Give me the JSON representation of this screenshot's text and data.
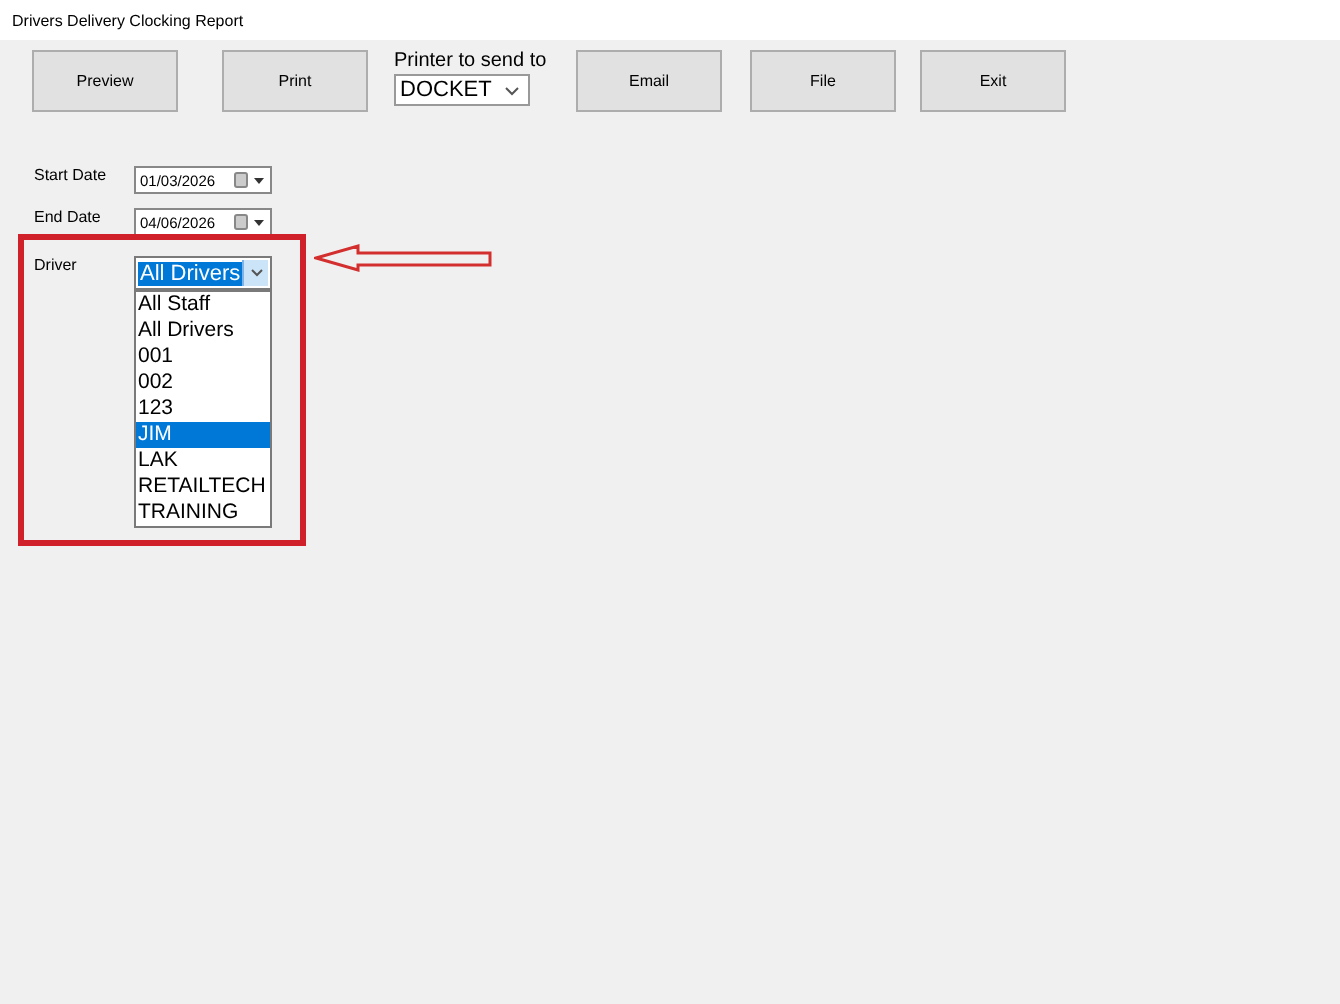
{
  "window": {
    "title": "Drivers Delivery Clocking Report"
  },
  "toolbar": [
    {
      "kind": "button",
      "label": "Preview"
    },
    {
      "kind": "button",
      "label": "Print"
    },
    {
      "kind": "printer",
      "label": "Printer to send to",
      "value": "DOCKET"
    },
    {
      "kind": "button",
      "label": "Email"
    },
    {
      "kind": "button",
      "label": "File"
    },
    {
      "kind": "button",
      "label": "Exit"
    }
  ],
  "dates": [
    {
      "label": "Start Date",
      "value": "01/03/2026"
    },
    {
      "label": "End Date",
      "value": "04/06/2026"
    }
  ],
  "driver": {
    "label": "Driver",
    "value": "All Drivers",
    "expanded": true,
    "options": [
      {
        "label": "All Staff",
        "highlighted": false
      },
      {
        "label": "All Drivers",
        "highlighted": false
      },
      {
        "label": "001",
        "highlighted": false
      },
      {
        "label": "002",
        "highlighted": false
      },
      {
        "label": "123",
        "highlighted": false
      },
      {
        "label": "JIM",
        "highlighted": true
      },
      {
        "label": "LAK",
        "highlighted": false
      },
      {
        "label": "RETAILTECH",
        "highlighted": false
      },
      {
        "label": "TRAINING",
        "highlighted": false
      }
    ]
  }
}
